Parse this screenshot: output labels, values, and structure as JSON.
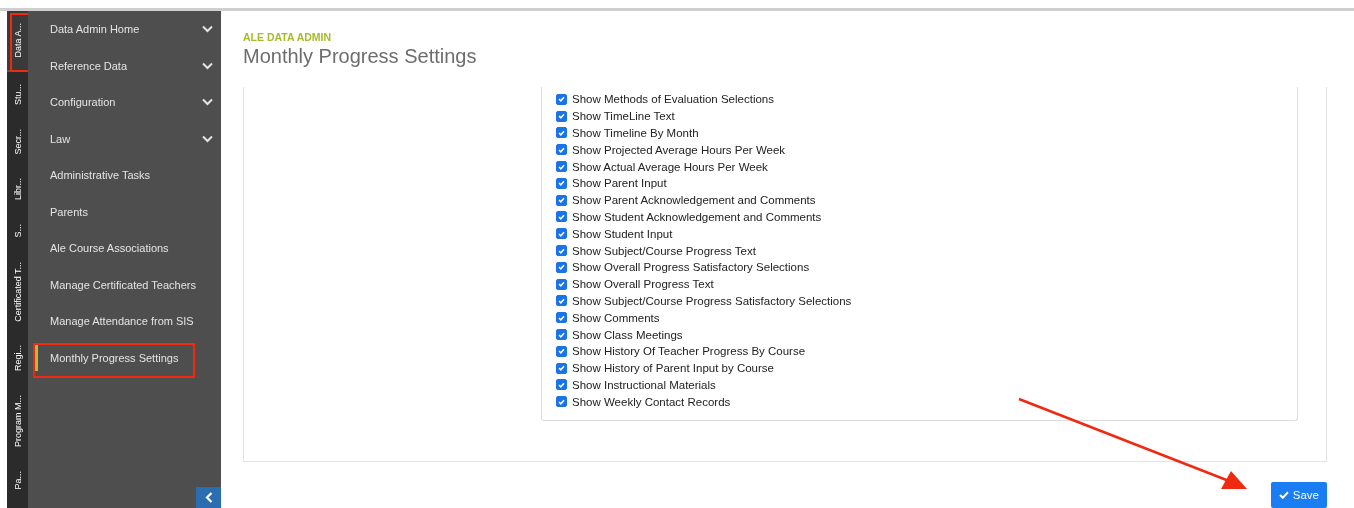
{
  "vertical_tabs": [
    {
      "label": "Data A...",
      "selected": true
    },
    {
      "label": "Stu...",
      "selected": false
    },
    {
      "label": "Secr...",
      "selected": false
    },
    {
      "label": "Libr...",
      "selected": false
    },
    {
      "label": "S...",
      "selected": false
    },
    {
      "label": "Certificated T...",
      "selected": false
    },
    {
      "label": "Regi...",
      "selected": false
    },
    {
      "label": "Program M...",
      "selected": false
    },
    {
      "label": "Pa...",
      "selected": false
    }
  ],
  "sidebar": {
    "items": [
      {
        "label": "Data Admin Home",
        "kind": "group",
        "selected": false
      },
      {
        "label": "Reference Data",
        "kind": "group",
        "selected": false
      },
      {
        "label": "Configuration",
        "kind": "group",
        "selected": false
      },
      {
        "label": "Law",
        "kind": "group",
        "selected": false
      },
      {
        "label": "Administrative Tasks",
        "kind": "link",
        "selected": false
      },
      {
        "label": "Parents",
        "kind": "link",
        "selected": false
      },
      {
        "label": "Ale Course Associations",
        "kind": "link",
        "selected": false
      },
      {
        "label": "Manage Certificated Teachers",
        "kind": "link",
        "selected": false
      },
      {
        "label": "Manage Attendance from SIS",
        "kind": "link",
        "selected": false
      },
      {
        "label": "Monthly Progress Settings",
        "kind": "link",
        "selected": true
      }
    ]
  },
  "header": {
    "breadcrumb": "ALE DATA ADMIN",
    "title": "Monthly Progress Settings"
  },
  "settings": [
    {
      "label": "Show Methods of Evaluation Selections",
      "checked": true
    },
    {
      "label": "Show TimeLine Text",
      "checked": true
    },
    {
      "label": "Show Timeline By Month",
      "checked": true
    },
    {
      "label": "Show Projected Average Hours Per Week",
      "checked": true
    },
    {
      "label": "Show Actual Average Hours Per Week",
      "checked": true
    },
    {
      "label": "Show Parent Input",
      "checked": true
    },
    {
      "label": "Show Parent Acknowledgement and Comments",
      "checked": true
    },
    {
      "label": "Show Student Acknowledgement and Comments",
      "checked": true
    },
    {
      "label": "Show Student Input",
      "checked": true
    },
    {
      "label": "Show Subject/Course Progress Text",
      "checked": true
    },
    {
      "label": "Show Overall Progress Satisfactory Selections",
      "checked": true
    },
    {
      "label": "Show Overall Progress Text",
      "checked": true
    },
    {
      "label": "Show Subject/Course Progress Satisfactory Selections",
      "checked": true
    },
    {
      "label": "Show Comments",
      "checked": true
    },
    {
      "label": "Show Class Meetings",
      "checked": true
    },
    {
      "label": "Show History Of Teacher Progress By Course",
      "checked": true
    },
    {
      "label": "Show History of Parent Input by Course",
      "checked": true
    },
    {
      "label": "Show Instructional Materials",
      "checked": true
    },
    {
      "label": "Show Weekly Contact Records",
      "checked": true
    }
  ],
  "save_button": "Save"
}
